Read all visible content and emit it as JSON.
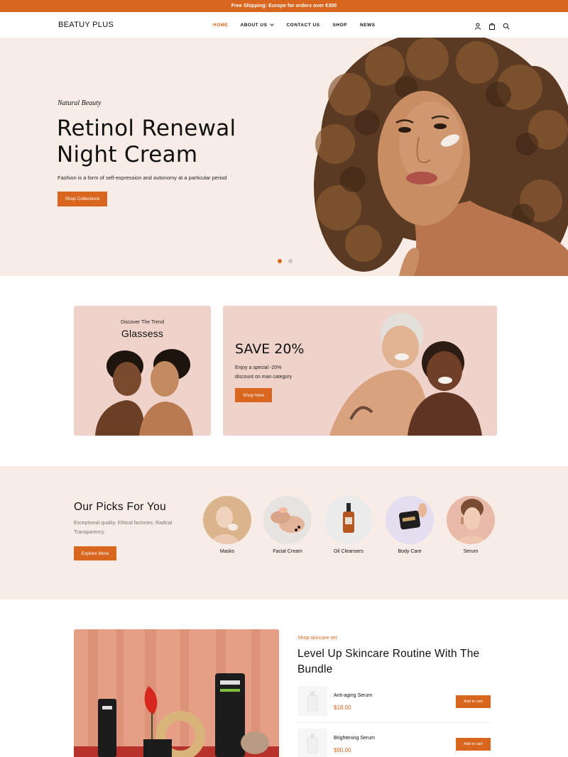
{
  "topbar": {
    "text": "Free Shipping: Europe for orders over €300"
  },
  "header": {
    "logo": "BEATUY PLUS",
    "nav": [
      "HOME",
      "ABOUT US",
      "CONTACT US",
      "SHOP",
      "NEWS"
    ],
    "icons": [
      "user-icon",
      "bag-icon",
      "search-icon"
    ]
  },
  "hero": {
    "eyebrow": "Natural Beauty",
    "title_line1": "Retinol Renewal",
    "title_line2": "Night Cream",
    "subtitle": "Fashion is a form of self-expression and autonomy at a particular period",
    "button": "Shop Collections",
    "slides": 2,
    "active_slide": 1
  },
  "promo": {
    "card1": {
      "eyebrow": "Discover The Trend",
      "title": "Glassess"
    },
    "card2": {
      "title": "SAVE 20%",
      "text_line1": "Enjoy a special -20%",
      "text_line2": "discount on man category",
      "button": "Shop Now"
    }
  },
  "picks": {
    "title": "Our Picks For You",
    "text_line1": "Exceptional quality. Ethical factories. Radical",
    "text_line2": "Transparency.",
    "button": "Explore More",
    "items": [
      {
        "label": "Masks"
      },
      {
        "label": "Facial Cream"
      },
      {
        "label": "Oil Cleansers"
      },
      {
        "label": "Body Care"
      },
      {
        "label": "Serum"
      }
    ]
  },
  "bundle": {
    "eyebrow": "Shop skincare set",
    "title_line1": "Level Up Skincare Routine With The",
    "title_line2": "Bundle",
    "products": [
      {
        "name": "Anti-aging Serum",
        "price": "$18.00",
        "button": "Add to cart"
      },
      {
        "name": "Brightening Serum",
        "price": "$90.00",
        "button": "Add to cart"
      }
    ]
  },
  "colors": {
    "accent": "#d9661f",
    "hero_bg": "#f8ece6",
    "card_bg": "#efd3cb"
  }
}
